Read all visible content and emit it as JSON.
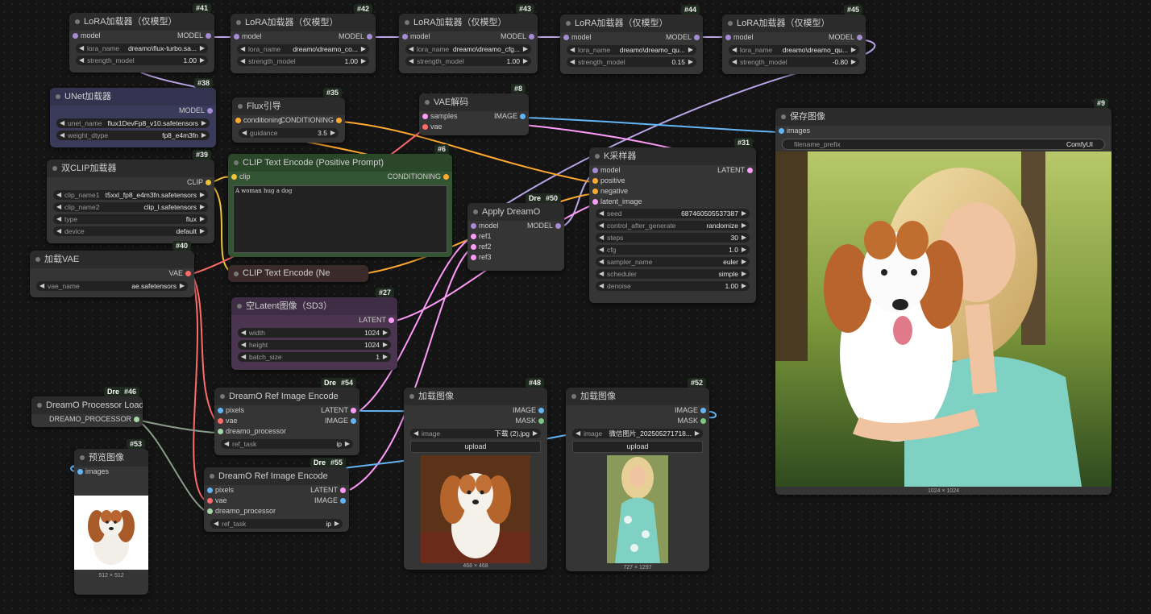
{
  "colors": {
    "model": "#a78bd6",
    "clip": "#f0c23a",
    "vae": "#ff6b6b",
    "conditioning": "#ffa931",
    "latent": "#ff9cf9",
    "image": "#64b5f6",
    "mask": "#81c784"
  },
  "lora41": {
    "id": "#41",
    "title": "LoRA加载器（仅模型）",
    "in": "model",
    "out": "MODEL",
    "lora_k": "lora_name",
    "lora_v": "dreamo\\flux-turbo.sa...",
    "str_k": "strength_model",
    "str_v": "1.00"
  },
  "lora42": {
    "id": "#42",
    "title": "LoRA加载器（仅模型）",
    "in": "model",
    "out": "MODEL",
    "lora_k": "lora_name",
    "lora_v": "dreamo\\dreamo_co...",
    "str_k": "strength_model",
    "str_v": "1.00"
  },
  "lora43": {
    "id": "#43",
    "title": "LoRA加载器（仅模型）",
    "in": "model",
    "out": "MODEL",
    "lora_k": "lora_name",
    "lora_v": "dreamo\\dreamo_cfg...",
    "str_k": "strength_model",
    "str_v": "1.00"
  },
  "lora44": {
    "id": "#44",
    "title": "LoRA加载器（仅模型）",
    "in": "model",
    "out": "MODEL",
    "lora_k": "lora_name",
    "lora_v": "dreamo\\dreamo_qu...",
    "str_k": "strength_model",
    "str_v": "0.15"
  },
  "lora45": {
    "id": "#45",
    "title": "LoRA加载器（仅模型）",
    "in": "model",
    "out": "MODEL",
    "lora_k": "lora_name",
    "lora_v": "dreamo\\dreamo_qu...",
    "str_k": "strength_model",
    "str_v": "-0.80"
  },
  "unet": {
    "id": "#38",
    "title": "UNet加载器",
    "out": "MODEL",
    "name_k": "unet_name",
    "name_v": "flux1DevFp8_v10.safetensors",
    "dtype_k": "weight_dtype",
    "dtype_v": "fp8_e4m3fn"
  },
  "flux": {
    "id": "#35",
    "title": "Flux引导",
    "in": "conditioning",
    "out": "CONDITIONING",
    "g_k": "guidance",
    "g_v": "3.5"
  },
  "vaedec": {
    "id": "#8",
    "title": "VAE解码",
    "in1": "samples",
    "in2": "vae",
    "out": "IMAGE"
  },
  "save": {
    "id": "#9",
    "title": "保存图像",
    "in": "images",
    "fp_k": "filename_prefix",
    "fp_v": "ComfyUI",
    "size": "1024 × 1024"
  },
  "dclip": {
    "id": "#39",
    "title": "双CLIP加载器",
    "out": "CLIP",
    "c1_k": "clip_name1",
    "c1_v": "t5xxl_fp8_e4m3fn.safetensors",
    "c2_k": "clip_name2",
    "c2_v": "clip_l.safetensors",
    "t_k": "type",
    "t_v": "flux",
    "d_k": "device",
    "d_v": "default"
  },
  "clippos": {
    "id": "#6",
    "title": "CLIP Text Encode (Positive Prompt)",
    "in": "clip",
    "out": "CONDITIONING",
    "text": "A woman hug a dog"
  },
  "ksampler": {
    "id": "#31",
    "title": "K采样器",
    "in1": "model",
    "in2": "positive",
    "in3": "negative",
    "in4": "latent_image",
    "out": "LATENT",
    "widgets": [
      {
        "k": "seed",
        "v": "687460505537387"
      },
      {
        "k": "control_after_generate",
        "v": "randomize"
      },
      {
        "k": "steps",
        "v": "30"
      },
      {
        "k": "cfg",
        "v": "1.0"
      },
      {
        "k": "sampler_name",
        "v": "euler"
      },
      {
        "k": "scheduler",
        "v": "simple"
      },
      {
        "k": "denoise",
        "v": "1.00"
      }
    ]
  },
  "apply": {
    "dre": "Dre",
    "id": "#50",
    "title": "Apply DreamO",
    "in1": "model",
    "in2": "ref1",
    "in3": "ref2",
    "in4": "ref3",
    "out": "MODEL"
  },
  "vae": {
    "id": "#40",
    "title": "加载VAE",
    "out": "VAE",
    "n_k": "vae_name",
    "n_v": "ae.safetensors"
  },
  "clipneg": {
    "title": "CLIP Text Encode (Ne"
  },
  "latent": {
    "id": "#27",
    "title": "空Latent图像（SD3）",
    "out": "LATENT",
    "w_k": "width",
    "w_v": "1024",
    "h_k": "height",
    "h_v": "1024",
    "b_k": "batch_size",
    "b_v": "1"
  },
  "proc": {
    "dre": "Dre",
    "id": "#46",
    "title": "DreamO Processor Loader",
    "out": "DREAMO_PROCESSOR"
  },
  "ref54": {
    "dre": "Dre",
    "id": "#54",
    "title": "DreamO Ref Image Encode",
    "in1": "pixels",
    "in2": "vae",
    "in3": "dreamo_processor",
    "out1": "LATENT",
    "out2": "IMAGE",
    "rt_k": "ref_task",
    "rt_v": "ip"
  },
  "ref55": {
    "dre": "Dre",
    "id": "#55",
    "title": "DreamO Ref Image Encode",
    "in1": "pixels",
    "in2": "vae",
    "in3": "dreamo_processor",
    "out1": "LATENT",
    "out2": "IMAGE",
    "rt_k": "ref_task",
    "rt_v": "ip"
  },
  "load48": {
    "id": "#48",
    "title": "加载图像",
    "out1": "IMAGE",
    "out2": "MASK",
    "img_k": "image",
    "img_v": "下载 (2).jpg",
    "upload": "upload",
    "size": "468 × 468"
  },
  "load52": {
    "id": "#52",
    "title": "加载图像",
    "out1": "IMAGE",
    "out2": "MASK",
    "img_k": "image",
    "img_v": "微信图片_202505271718...",
    "upload": "upload",
    "size": "727 × 1297"
  },
  "preview": {
    "id": "#53",
    "title": "预览图像",
    "in": "images",
    "size": "512 × 512"
  },
  "arrow_l": "◀",
  "arrow_r": "▶"
}
